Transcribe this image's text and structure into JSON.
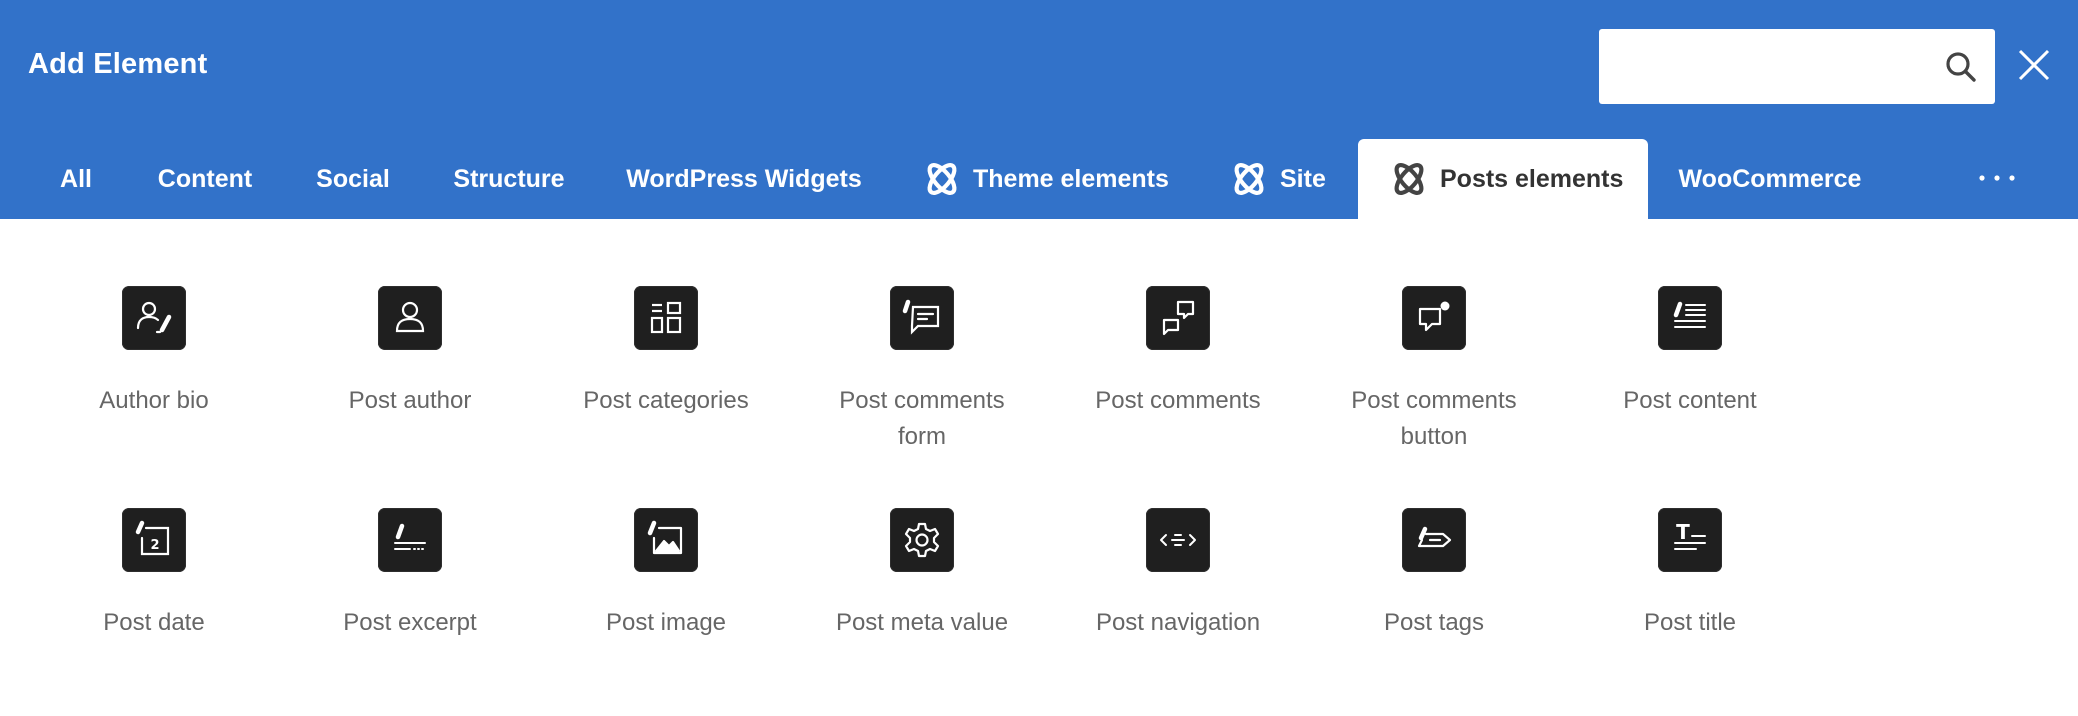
{
  "header": {
    "title": "Add Element",
    "search_placeholder": "",
    "search_value": ""
  },
  "tabs": [
    {
      "label": "All",
      "icon": null,
      "active": false
    },
    {
      "label": "Content",
      "icon": null,
      "active": false
    },
    {
      "label": "Social",
      "icon": null,
      "active": false
    },
    {
      "label": "Structure",
      "icon": null,
      "active": false
    },
    {
      "label": "WordPress Widgets",
      "icon": null,
      "active": false
    },
    {
      "label": "Theme elements",
      "icon": "atom-logo-icon",
      "active": false
    },
    {
      "label": "Site",
      "icon": "atom-logo-icon",
      "active": false
    },
    {
      "label": "Posts elements",
      "icon": "atom-logo-icon",
      "active": true
    },
    {
      "label": "WooCommerce",
      "icon": null,
      "active": false
    }
  ],
  "elements": [
    {
      "label": "Author bio",
      "icon": "author-bio-icon"
    },
    {
      "label": "Post author",
      "icon": "person-icon"
    },
    {
      "label": "Post categories",
      "icon": "categories-icon"
    },
    {
      "label": "Post comments form",
      "icon": "comment-form-icon"
    },
    {
      "label": "Post comments",
      "icon": "comments-icon"
    },
    {
      "label": "Post comments button",
      "icon": "comment-notification-icon"
    },
    {
      "label": "Post content",
      "icon": "content-lines-icon"
    },
    {
      "label": "Post date",
      "icon": "calendar-date-icon"
    },
    {
      "label": "Post excerpt",
      "icon": "excerpt-icon"
    },
    {
      "label": "Post image",
      "icon": "image-icon"
    },
    {
      "label": "Post meta value",
      "icon": "gear-icon"
    },
    {
      "label": "Post navigation",
      "icon": "navigation-arrows-icon"
    },
    {
      "label": "Post tags",
      "icon": "tag-icon"
    },
    {
      "label": "Post title",
      "icon": "title-t-icon"
    }
  ],
  "colors": {
    "header_bg": "#3272c9",
    "icon_tile_bg": "#1f1f1f",
    "label_text": "#666666",
    "active_tab_text": "#333333"
  }
}
